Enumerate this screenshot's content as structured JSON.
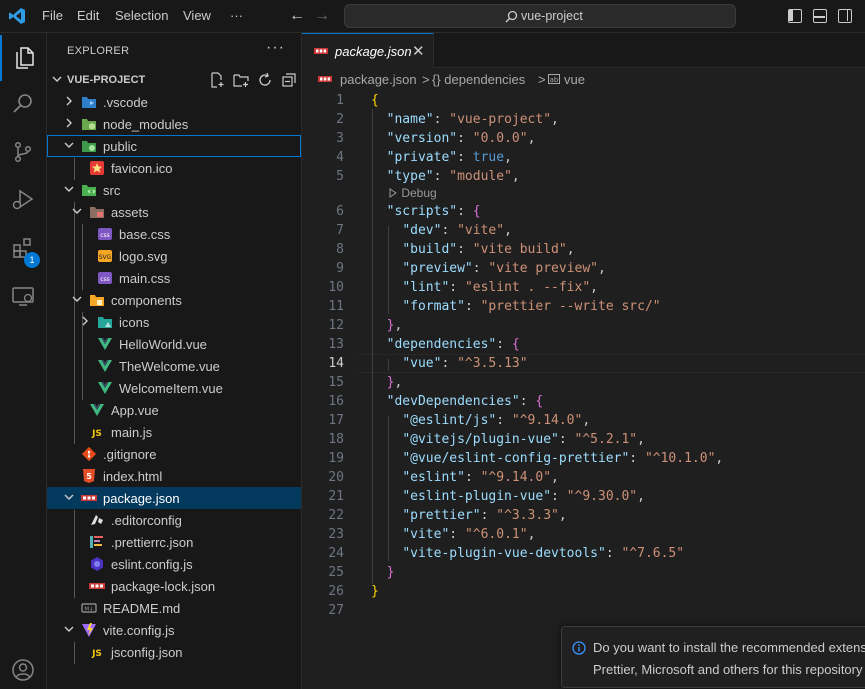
{
  "titlebar": {
    "menus": [
      "File",
      "Edit",
      "Selection",
      "View",
      "···"
    ],
    "search_text": "vue-project"
  },
  "activity": {
    "extensions_badge": "1"
  },
  "explorer": {
    "title": "EXPLORER",
    "more": "···",
    "section": "VUE-PROJECT",
    "items": [
      {
        "label": ".vscode",
        "icon": "vscode-folder-icon"
      },
      {
        "label": "node_modules",
        "icon": "node-folder-icon"
      },
      {
        "label": "public",
        "icon": "public-folder-icon"
      },
      {
        "label": "favicon.ico",
        "icon": "favicon-file-icon"
      },
      {
        "label": "src",
        "icon": "src-folder-icon"
      },
      {
        "label": "assets",
        "icon": "assets-folder-icon"
      },
      {
        "label": "base.css",
        "icon": "css-file-icon"
      },
      {
        "label": "logo.svg",
        "icon": "svg-file-icon"
      },
      {
        "label": "main.css",
        "icon": "css-file-icon"
      },
      {
        "label": "components",
        "icon": "components-folder-icon"
      },
      {
        "label": "icons",
        "icon": "icons-folder-icon"
      },
      {
        "label": "HelloWorld.vue",
        "icon": "vue-file-icon"
      },
      {
        "label": "TheWelcome.vue",
        "icon": "vue-file-icon"
      },
      {
        "label": "WelcomeItem.vue",
        "icon": "vue-file-icon"
      },
      {
        "label": "App.vue",
        "icon": "vue-file-icon"
      },
      {
        "label": "main.js",
        "icon": "js-file-icon"
      },
      {
        "label": ".gitignore",
        "icon": "git-file-icon"
      },
      {
        "label": "index.html",
        "icon": "html-file-icon"
      },
      {
        "label": "package.json",
        "icon": "npm-file-icon"
      },
      {
        "label": ".editorconfig",
        "icon": "editorconfig-file-icon"
      },
      {
        "label": ".prettierrc.json",
        "icon": "prettier-file-icon"
      },
      {
        "label": "eslint.config.js",
        "icon": "eslint-file-icon"
      },
      {
        "label": "package-lock.json",
        "icon": "npm-file-icon"
      },
      {
        "label": "README.md",
        "icon": "markdown-file-icon"
      },
      {
        "label": "vite.config.js",
        "icon": "vite-file-icon"
      },
      {
        "label": "jsconfig.json",
        "icon": "js-file-icon"
      }
    ]
  },
  "editor": {
    "tab": "package.json",
    "tab_close": "✕",
    "breadcrumb": [
      "package.json",
      ">",
      "{} dependencies",
      ">",
      "vue"
    ],
    "codelens": "Debug",
    "line_numbers": [
      "1",
      "2",
      "3",
      "4",
      "5",
      "6",
      "7",
      "8",
      "9",
      "10",
      "11",
      "12",
      "13",
      "14",
      "15",
      "16",
      "17",
      "18",
      "19",
      "20",
      "21",
      "22",
      "23",
      "24",
      "25",
      "26",
      "27"
    ],
    "tokens": {
      "l1": "{",
      "l2k": "\"name\"",
      "l2v": "\"vue-project\"",
      "l3k": "\"version\"",
      "l3v": "\"0.0.0\"",
      "l4k": "\"private\"",
      "l4v": "true",
      "l5k": "\"type\"",
      "l5v": "\"module\"",
      "l6k": "\"scripts\"",
      "l6b": "{",
      "l7k": "\"dev\"",
      "l7v": "\"vite\"",
      "l8k": "\"build\"",
      "l8v": "\"vite build\"",
      "l9k": "\"preview\"",
      "l9v": "\"vite preview\"",
      "l10k": "\"lint\"",
      "l10v": "\"eslint . --fix\"",
      "l11k": "\"format\"",
      "l11v": "\"prettier --write src/\"",
      "l12b": "}",
      "l13k": "\"dependencies\"",
      "l13b": "{",
      "l14k": "\"vue\"",
      "l14v": "\"^3.5.13\"",
      "l15b": "}",
      "l16k": "\"devDependencies\"",
      "l16b": "{",
      "l17k": "\"@eslint/js\"",
      "l17v": "\"^9.14.0\"",
      "l18k": "\"@vitejs/plugin-vue\"",
      "l18v": "\"^5.2.1\"",
      "l19k": "\"@vue/eslint-config-prettier\"",
      "l19v": "\"^10.1.0\"",
      "l20k": "\"eslint\"",
      "l20v": "\"^9.14.0\"",
      "l21k": "\"eslint-plugin-vue\"",
      "l21v": "\"^9.30.0\"",
      "l22k": "\"prettier\"",
      "l22v": "\"^3.3.3\"",
      "l23k": "\"vite\"",
      "l23v": "\"^6.0.1\"",
      "l24k": "\"vite-plugin-vue-devtools\"",
      "l24v": "\"^7.6.5\"",
      "l25b": "}",
      "l26": "}"
    }
  },
  "notification": {
    "line1": "Do you want to install the recommended extens",
    "line2": "Prettier, Microsoft and others for this repository"
  }
}
